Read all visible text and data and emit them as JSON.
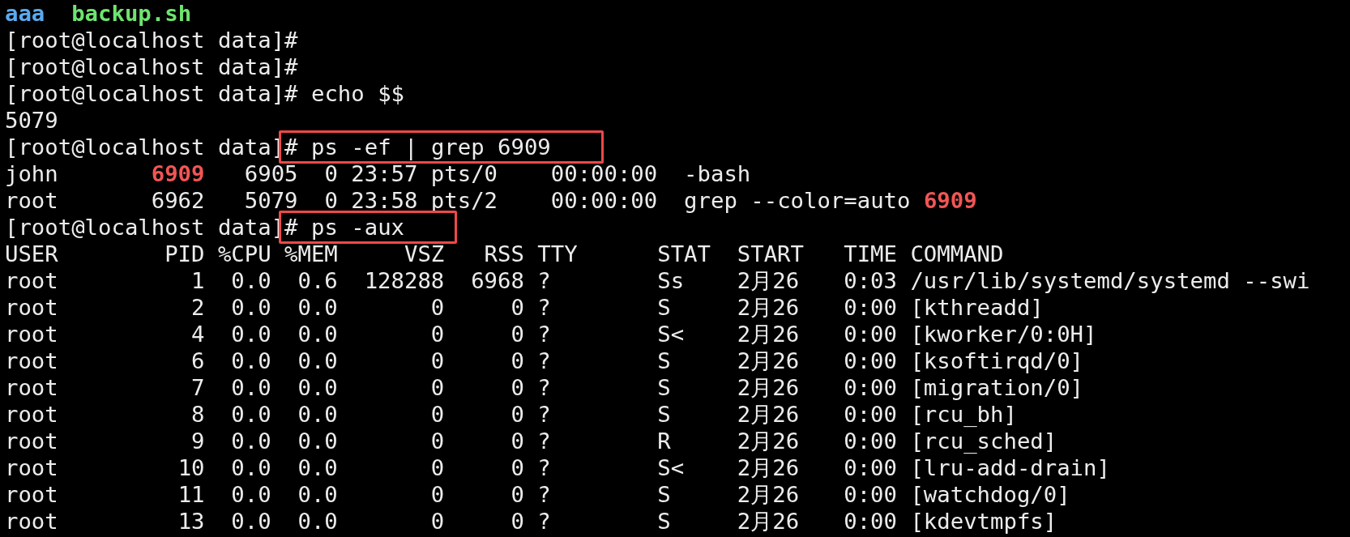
{
  "lines": [
    {
      "kind": "listing",
      "entries": [
        {
          "name": "aaa",
          "color": "#5aaaf0"
        },
        {
          "name": "backup.sh",
          "color": "#6ee46e"
        }
      ]
    },
    {
      "kind": "prompt",
      "prompt": "[root@localhost data]#",
      "boxed": false
    },
    {
      "kind": "prompt",
      "prompt": "[root@localhost data]#",
      "boxed": false
    },
    {
      "kind": "prompt",
      "prompt": "[root@localhost data]#",
      "command": "echo $$",
      "boxed": false
    },
    {
      "kind": "output",
      "text": "5079"
    },
    {
      "kind": "prompt",
      "prompt": "[root@localhost data]#",
      "command": "ps -ef | grep 6909",
      "boxed": true
    },
    {
      "kind": "process",
      "cells": [
        "john",
        "**6909**",
        "6905",
        "0",
        "23:57",
        "pts/0",
        "00:00:00",
        "-bash"
      ]
    },
    {
      "kind": "process",
      "cells": [
        "root",
        "6962",
        "5079",
        "0",
        "23:58",
        "pts/2",
        "00:00:00",
        "grep --color=auto **6909**"
      ]
    },
    {
      "kind": "prompt",
      "prompt": "[root@localhost data]#",
      "command": "ps -aux",
      "boxed": true
    },
    {
      "kind": "table",
      "columns": [
        "USER",
        "PID",
        "%CPU",
        "%MEM",
        "VSZ",
        "RSS",
        "TTY",
        "STAT",
        "START",
        "TIME",
        "COMMAND"
      ],
      "rows": [
        [
          "root",
          "1",
          "0.0",
          "0.6",
          "128288",
          "6968",
          "?",
          "Ss",
          "2月26",
          "0:03",
          "/usr/lib/systemd/systemd --swi"
        ],
        [
          "root",
          "2",
          "0.0",
          "0.0",
          "0",
          "0",
          "?",
          "S",
          "2月26",
          "0:00",
          "[kthreadd]"
        ],
        [
          "root",
          "4",
          "0.0",
          "0.0",
          "0",
          "0",
          "?",
          "S<",
          "2月26",
          "0:00",
          "[kworker/0:0H]"
        ],
        [
          "root",
          "6",
          "0.0",
          "0.0",
          "0",
          "0",
          "?",
          "S",
          "2月26",
          "0:00",
          "[ksoftirqd/0]"
        ],
        [
          "root",
          "7",
          "0.0",
          "0.0",
          "0",
          "0",
          "?",
          "S",
          "2月26",
          "0:00",
          "[migration/0]"
        ],
        [
          "root",
          "8",
          "0.0",
          "0.0",
          "0",
          "0",
          "?",
          "S",
          "2月26",
          "0:00",
          "[rcu_bh]"
        ],
        [
          "root",
          "9",
          "0.0",
          "0.0",
          "0",
          "0",
          "?",
          "R",
          "2月26",
          "0:00",
          "[rcu_sched]"
        ],
        [
          "root",
          "10",
          "0.0",
          "0.0",
          "0",
          "0",
          "?",
          "S<",
          "2月26",
          "0:00",
          "[lru-add-drain]"
        ],
        [
          "root",
          "11",
          "0.0",
          "0.0",
          "0",
          "0",
          "?",
          "S",
          "2月26",
          "0:00",
          "[watchdog/0]"
        ],
        [
          "root",
          "13",
          "0.0",
          "0.0",
          "0",
          "0",
          "?",
          "S",
          "2月26",
          "0:00",
          "[kdevtmpfs]"
        ]
      ]
    }
  ]
}
